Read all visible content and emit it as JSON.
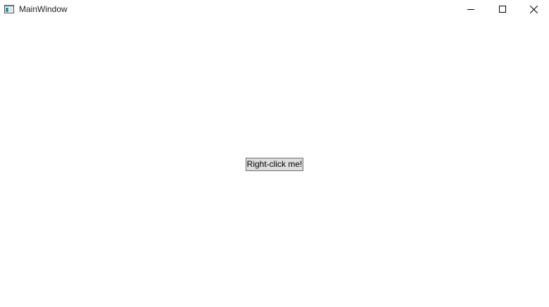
{
  "window": {
    "title": "MainWindow",
    "app_icon": "window-app-icon",
    "controls": {
      "minimize_icon": "minimize-icon",
      "maximize_icon": "maximize-icon",
      "close_icon": "close-icon"
    }
  },
  "main": {
    "button_label": "Right-click me!"
  },
  "colors": {
    "background": "#ffffff",
    "button_face": "#dddddd",
    "button_border": "#707070",
    "icon_teal": "#2f8f9f"
  }
}
